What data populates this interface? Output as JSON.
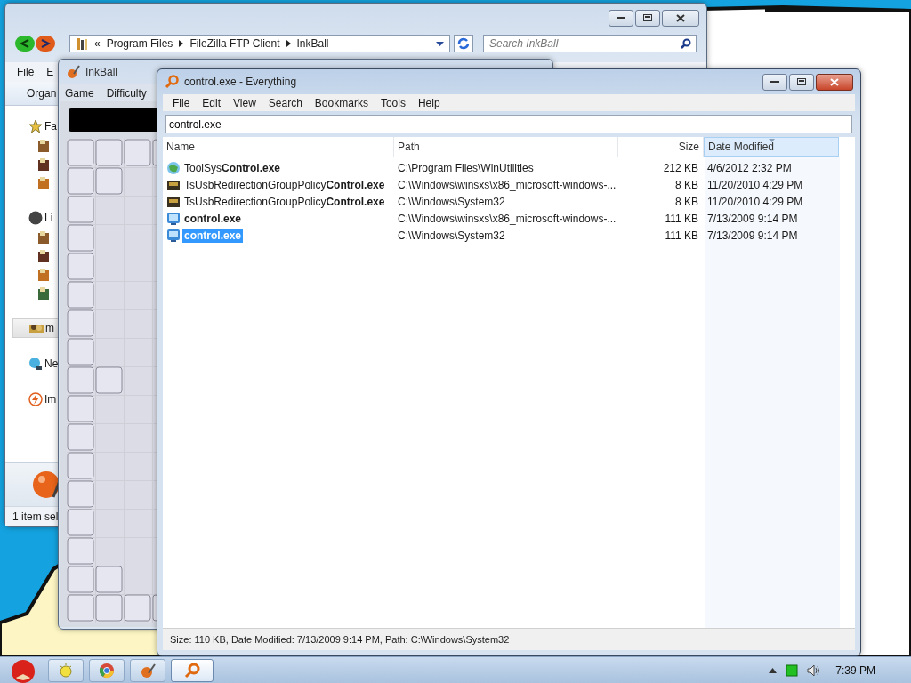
{
  "explorer": {
    "active": false,
    "address": {
      "overflow": "«",
      "crumbs": [
        "Program Files",
        "FileZilla FTP Client",
        "InkBall"
      ]
    },
    "search": {
      "placeholder": "Search InkBall"
    },
    "menu": [
      "File",
      "E"
    ],
    "toolbar": [
      "Organ"
    ],
    "nav": [
      {
        "label": "Fa",
        "kind": "favorites",
        "selected": false
      },
      {
        "label": "Li",
        "kind": "libraries",
        "selected": false
      },
      {
        "label": "m",
        "kind": "homegroup",
        "selected": true
      },
      {
        "label": "Ne",
        "kind": "network",
        "selected": false
      },
      {
        "label": "Im",
        "kind": "flash",
        "selected": false
      }
    ],
    "status": "1 item sel"
  },
  "inkball": {
    "active": false,
    "title": "InkBall",
    "menu": [
      "Game",
      "Difficulty"
    ]
  },
  "everything": {
    "active": true,
    "title": "control.exe - Everything",
    "menu": [
      "File",
      "Edit",
      "View",
      "Search",
      "Bookmarks",
      "Tools",
      "Help"
    ],
    "search": {
      "value": "control.exe"
    },
    "columns": [
      {
        "label": "Name",
        "selected": false
      },
      {
        "label": "Path",
        "selected": false
      },
      {
        "label": "Size",
        "selected": false
      },
      {
        "label": "Date Modified",
        "selected": true
      }
    ],
    "rows": [
      {
        "kind": "utility",
        "name": "ToolSys**Control.exe**",
        "bold": false,
        "path": "C:\\Program Files\\WinUtilities",
        "size": "212 KB",
        "date": "4/6/2012 2:32 PM",
        "selected": false
      },
      {
        "kind": "policy",
        "name": "TsUsbRedirectionGroupPolicy**Control.exe**",
        "bold": false,
        "path": "C:\\Windows\\winsxs\\x86_microsoft-windows-...",
        "size": "8 KB",
        "date": "11/20/2010 4:29 PM",
        "selected": false
      },
      {
        "kind": "policy",
        "name": "TsUsbRedirectionGroupPolicy**Control.exe**",
        "bold": false,
        "path": "C:\\Windows\\System32",
        "size": "8 KB",
        "date": "11/20/2010 4:29 PM",
        "selected": false
      },
      {
        "kind": "control",
        "name": "control.exe",
        "bold": true,
        "path": "C:\\Windows\\winsxs\\x86_microsoft-windows-...",
        "size": "111 KB",
        "date": "7/13/2009 9:14 PM",
        "selected": false
      },
      {
        "kind": "control",
        "name": "control.exe",
        "bold": true,
        "path": "C:\\Windows\\System32",
        "size": "111 KB",
        "date": "7/13/2009 9:14 PM",
        "selected": true
      }
    ],
    "status": "Size: 110 KB, Date Modified: 7/13/2009 9:14 PM, Path: C:\\Windows\\System32"
  },
  "taskbar": {
    "buttons": [
      {
        "kind": "sun",
        "selected": false
      },
      {
        "kind": "browser",
        "selected": false
      },
      {
        "kind": "inkball",
        "selected": false
      },
      {
        "kind": "search",
        "selected": true
      }
    ],
    "clock": "7:39 PM"
  }
}
